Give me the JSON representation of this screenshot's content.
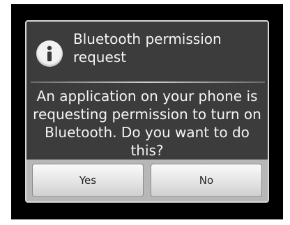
{
  "dialog": {
    "title": "Bluetooth permission request",
    "message": "An application on your phone is requesting permission to turn on Bluetooth. Do you want to do this?",
    "icon": "info-icon",
    "buttons": {
      "yes_label": "Yes",
      "no_label": "No"
    }
  },
  "colors": {
    "dialog_background": "#3c3c3c",
    "button_bar": "#b7b7b7",
    "text": "#f4f4f4"
  }
}
